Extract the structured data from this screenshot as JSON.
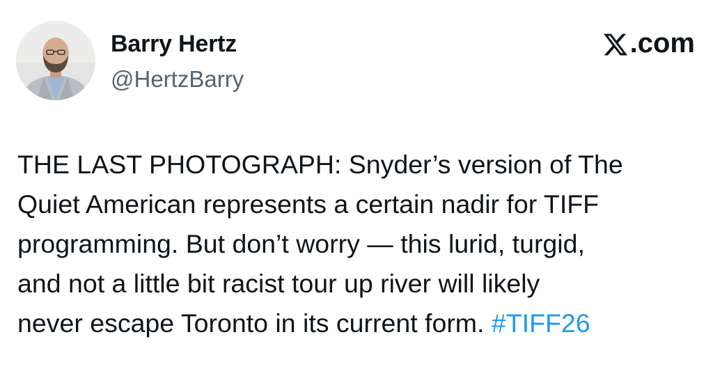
{
  "author": {
    "name": "Barry Hertz",
    "handle": "@HertzBarry"
  },
  "source": {
    "icon": "x-logo-icon",
    "label": ".com"
  },
  "tweet": {
    "lines": [
      "THE LAST PHOTOGRAPH: Snyder’s version of The",
      "Quiet American represents a certain nadir for TIFF",
      "programming. But don’t worry — this lurid, turgid,",
      "and not a little bit racist tour up river will likely",
      "never escape Toronto in its current form. "
    ],
    "hashtag": "#TIFF26"
  },
  "colors": {
    "text": "#0f1419",
    "secondary": "#536471",
    "link": "#1d9bf0",
    "background": "#ffffff"
  }
}
